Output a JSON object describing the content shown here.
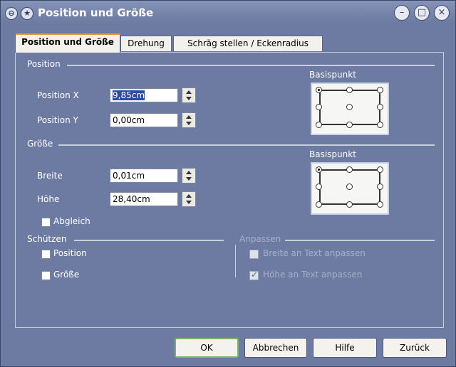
{
  "window": {
    "title": "Position und Größe"
  },
  "tabs": [
    {
      "label": "Position und Größe"
    },
    {
      "label": "Drehung"
    },
    {
      "label": "Schräg stellen / Eckenradius"
    }
  ],
  "position_group": {
    "title": "Position",
    "pos_x_label": "Position X",
    "pos_x_value": "9,85cm",
    "pos_y_label": "Position Y",
    "pos_y_value": "0,00cm",
    "basepoint_label": "Basispunkt"
  },
  "size_group": {
    "title": "Größe",
    "width_label": "Breite",
    "width_value": "0,01cm",
    "height_label": "Höhe",
    "height_value": "28,40cm",
    "keep_ratio_label": "Abgleich",
    "basepoint_label": "Basispunkt"
  },
  "protect_group": {
    "title": "Schützen",
    "position_label": "Position",
    "size_label": "Größe"
  },
  "adapt_group": {
    "title": "Anpassen",
    "fit_width_label": "Breite an Text anpassen",
    "fit_height_label": "Höhe an Text anpassen"
  },
  "buttons": {
    "ok": "OK",
    "cancel": "Abbrechen",
    "help": "Hilfe",
    "reset": "Zurück"
  },
  "icons": {
    "window_menu": "window-menu-icon",
    "pin": "pin-icon",
    "minimize": "minimize-icon",
    "maximize": "maximize-icon",
    "close": "close-icon"
  }
}
